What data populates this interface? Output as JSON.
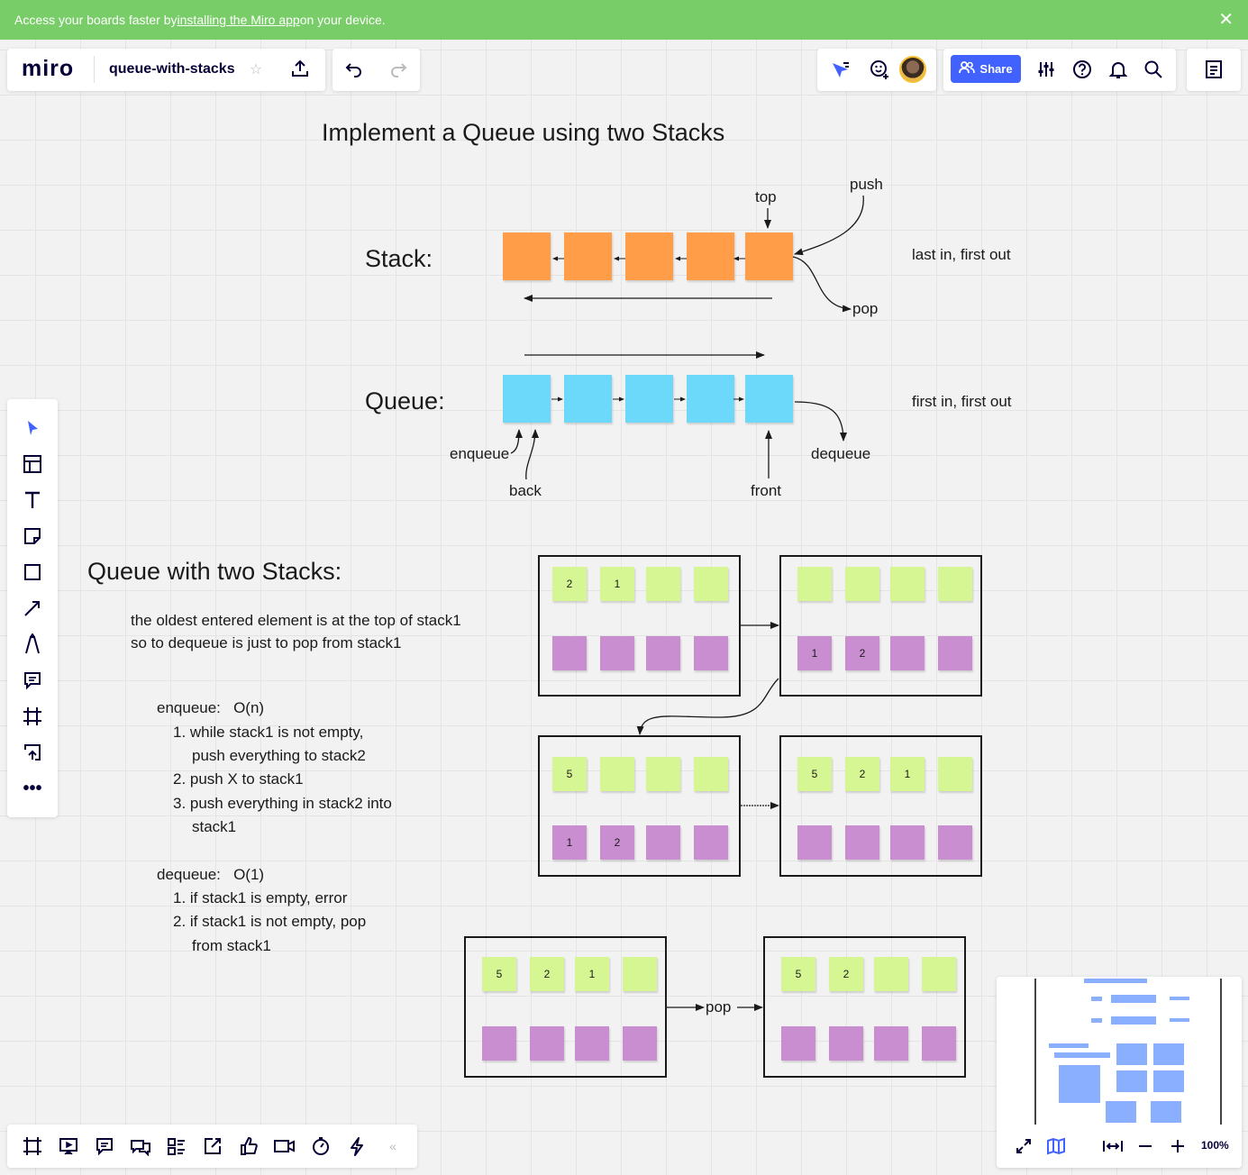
{
  "banner": {
    "text_before": "Access your boards faster by ",
    "link_text": "installing the Miro app",
    "text_after": " on your device."
  },
  "app": {
    "logo": "miro",
    "board_name": "queue-with-stacks"
  },
  "toolbar_right": {
    "share_label": "Share",
    "zoom_level": "100%"
  },
  "board": {
    "title": "Implement a Queue using two Stacks",
    "stack_label": "Stack:",
    "queue_label": "Queue:",
    "stack_top": "top",
    "stack_push": "push",
    "stack_pop": "pop",
    "stack_desc": "last in, first out",
    "queue_desc": "first in, first out",
    "enqueue": "enqueue",
    "back": "back",
    "front": "front",
    "dequeue": "dequeue",
    "section_heading": "Queue with two Stacks:",
    "note_line1": "the oldest entered element is at the top of stack1",
    "note_line2": "so to dequeue is just to pop from stack1",
    "enqueue_heading": "enqueue:   O(n)",
    "enqueue_steps": [
      "1. while stack1 is not empty,",
      "push everything to stack2",
      "2. push X to stack1",
      "3. push everything in stack2 into",
      "stack1"
    ],
    "dequeue_heading": "dequeue:   O(1)",
    "dequeue_steps": [
      "1. if stack1 is empty, error",
      "2. if stack1 is not empty, pop",
      "from stack1"
    ],
    "pop_arrow_label": "pop",
    "frames": [
      {
        "top": [
          "2",
          "1",
          "",
          ""
        ],
        "bottom": [
          "",
          "",
          "",
          ""
        ]
      },
      {
        "top": [
          "",
          "",
          "",
          ""
        ],
        "bottom": [
          "1",
          "2",
          "",
          ""
        ]
      },
      {
        "top": [
          "5",
          "",
          "",
          ""
        ],
        "bottom": [
          "1",
          "2",
          "",
          ""
        ]
      },
      {
        "top": [
          "5",
          "2",
          "1",
          ""
        ],
        "bottom": [
          "",
          "",
          "",
          ""
        ]
      },
      {
        "top": [
          "5",
          "2",
          "1",
          ""
        ],
        "bottom": [
          "",
          "",
          "",
          ""
        ]
      },
      {
        "top": [
          "5",
          "2",
          "",
          ""
        ],
        "bottom": [
          "",
          "",
          "",
          ""
        ]
      }
    ]
  },
  "colors": {
    "banner": "#78cd68",
    "accent": "#4262ff",
    "stack_sticky": "#ff9d48",
    "queue_sticky": "#6cd8fa",
    "green_sticky": "#d5f692",
    "purple_sticky": "#c98ecf"
  }
}
